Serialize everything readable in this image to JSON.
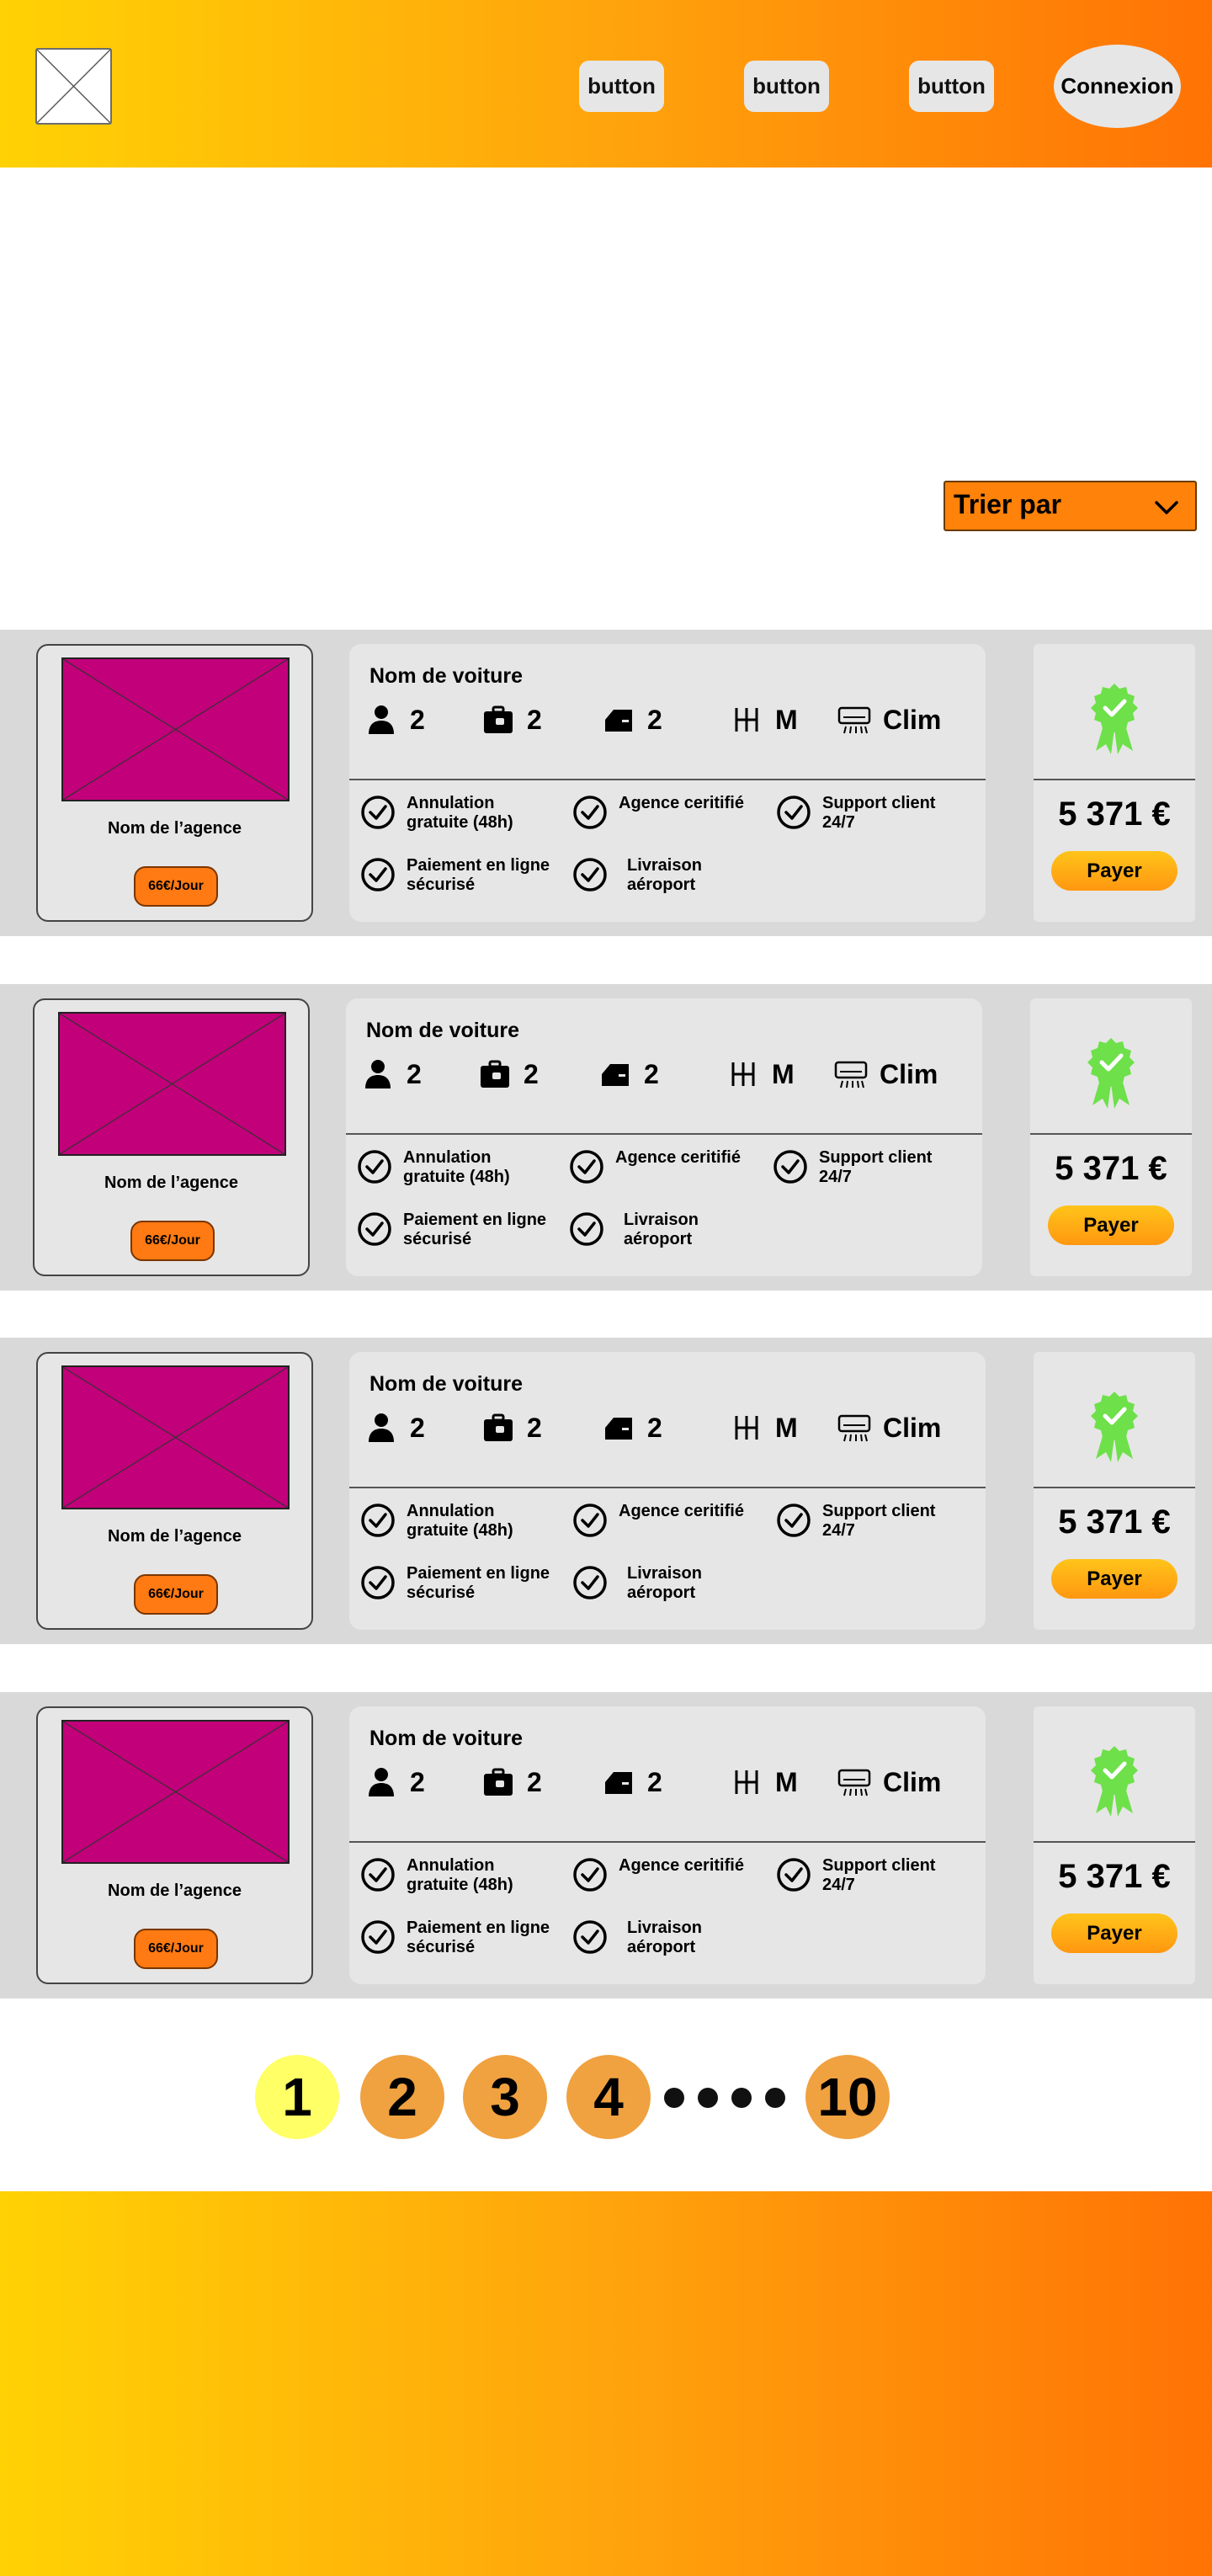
{
  "header": {
    "nav_buttons": [
      "button",
      "button",
      "button"
    ],
    "login_label": "Connexion"
  },
  "sort": {
    "label": "Trier par"
  },
  "listings": [
    {
      "agency_name": "Nom de l’agence",
      "daily_price": "66€/Jour",
      "car_name": "Nom de voiture",
      "specs": {
        "seats": "2",
        "luggage": "2",
        "doors": "2",
        "transmission": "M",
        "ac": "Clim"
      },
      "features": [
        "Annulation gratuite (48h)",
        "Agence ceritifié",
        "Support client 24/7",
        "Paiement en ligne sécurisé",
        "Livraison aéroport"
      ],
      "total_price": "5 371 €",
      "pay_label": "Payer"
    },
    {
      "agency_name": "Nom de l’agence",
      "daily_price": "66€/Jour",
      "car_name": "Nom de voiture",
      "specs": {
        "seats": "2",
        "luggage": "2",
        "doors": "2",
        "transmission": "M",
        "ac": "Clim"
      },
      "features": [
        "Annulation gratuite (48h)",
        "Agence ceritifié",
        "Support client 24/7",
        "Paiement en ligne sécurisé",
        "Livraison aéroport"
      ],
      "total_price": "5 371 €",
      "pay_label": "Payer"
    },
    {
      "agency_name": "Nom de l’agence",
      "daily_price": "66€/Jour",
      "car_name": "Nom de voiture",
      "specs": {
        "seats": "2",
        "luggage": "2",
        "doors": "2",
        "transmission": "M",
        "ac": "Clim"
      },
      "features": [
        "Annulation gratuite (48h)",
        "Agence ceritifié",
        "Support client 24/7",
        "Paiement en ligne sécurisé",
        "Livraison aéroport"
      ],
      "total_price": "5 371 €",
      "pay_label": "Payer"
    },
    {
      "agency_name": "Nom de l’agence",
      "daily_price": "66€/Jour",
      "car_name": "Nom de voiture",
      "specs": {
        "seats": "2",
        "luggage": "2",
        "doors": "2",
        "transmission": "M",
        "ac": "Clim"
      },
      "features": [
        "Annulation gratuite (48h)",
        "Agence ceritifié",
        "Support client 24/7",
        "Paiement en ligne sécurisé",
        "Livraison aéroport"
      ],
      "total_price": "5 371 €",
      "pay_label": "Payer"
    }
  ],
  "pagination": {
    "pages": [
      "1",
      "2",
      "3",
      "4",
      "10"
    ],
    "active": "1"
  },
  "icons": {
    "seats": "person-icon",
    "luggage": "suitcase-icon",
    "doors": "car-door-icon",
    "transmission": "gear-shift-icon",
    "ac": "air-conditioner-icon",
    "feature": "check-circle-icon",
    "badge": "certified-badge-icon",
    "sort": "chevron-down-icon"
  },
  "colors": {
    "gradient_start": "#ffd204",
    "gradient_end": "#ff7305",
    "image_placeholder": "#c2007a",
    "badge": "#6ee04a",
    "page_active": "#ffff66",
    "page_inactive": "#f0a140"
  }
}
